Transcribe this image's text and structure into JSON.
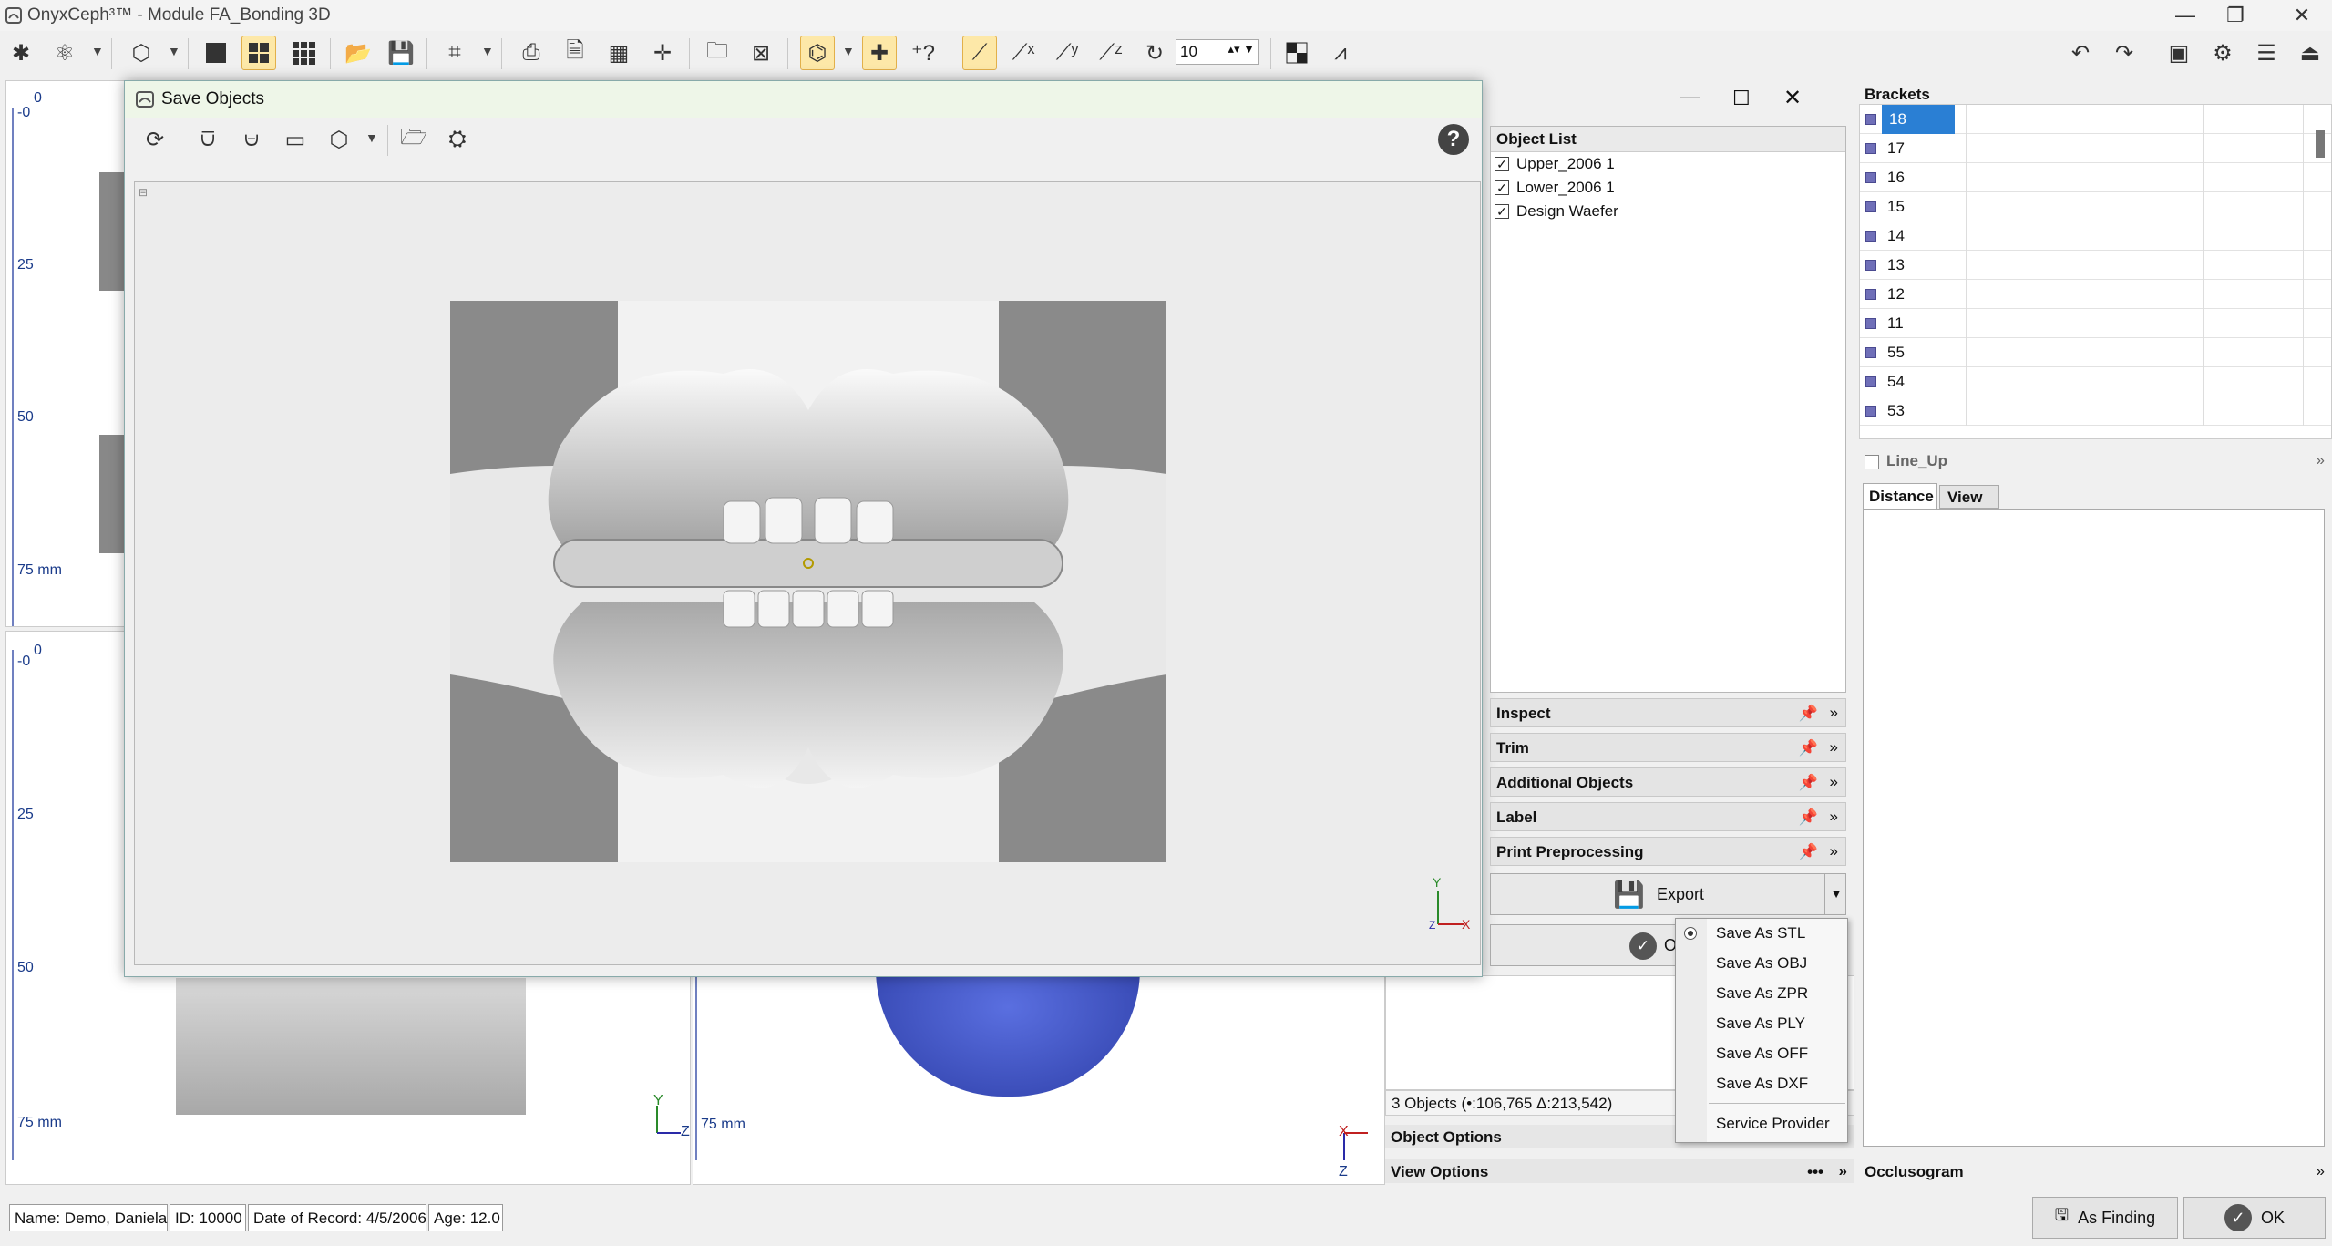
{
  "window": {
    "title": "OnyxCeph³™ - Module FA_Bonding 3D",
    "minimize_glyph": "—",
    "restore_glyph": "❐",
    "close_glyph": "✕"
  },
  "toolbar": {
    "zoom_value": "10"
  },
  "viewports": {
    "top_left": {
      "ticks": [
        "0",
        "-0",
        "25",
        "50",
        "75 mm"
      ]
    },
    "bottom_left": {
      "ticks": [
        "0",
        "-0",
        "25",
        "50",
        "75 mm"
      ]
    },
    "bottom_middle": {
      "tick": "75 mm"
    },
    "axis_y": "Y",
    "axis_z": "Z",
    "axis_x": "X"
  },
  "dialog": {
    "title": "Save Objects",
    "help_glyph": "?",
    "object_list": {
      "header": "Object List",
      "items": [
        {
          "label": "Upper_2006 1",
          "checked": true
        },
        {
          "label": "Lower_2006 1",
          "checked": true
        },
        {
          "label": "Design Waefer",
          "checked": true
        }
      ]
    },
    "sections": {
      "inspect": "Inspect",
      "trim": "Trim",
      "additional_objects": "Additional Objects",
      "label": "Label",
      "print_preprocessing": "Print Preprocessing"
    },
    "export_label": "Export",
    "ok_label_partial": "O",
    "axes": {
      "y": "Y",
      "x": "X",
      "z": "Z"
    }
  },
  "context_menu": {
    "items": [
      {
        "label": "Save As STL",
        "selected": true
      },
      {
        "label": "Save As OBJ",
        "selected": false
      },
      {
        "label": "Save As ZPR",
        "selected": false
      },
      {
        "label": "Save As PLY",
        "selected": false
      },
      {
        "label": "Save As OFF",
        "selected": false
      },
      {
        "label": "Save As DXF",
        "selected": false
      }
    ],
    "service_provider": "Service Provider"
  },
  "lower_panel": {
    "objects_count": "3 Objects (•:106,765 Δ:213,542)",
    "object_options": "Object Options",
    "view_options": "View Options",
    "more_glyph": "•••"
  },
  "brackets": {
    "header": "Brackets",
    "rows": [
      "18",
      "17",
      "16",
      "15",
      "14",
      "13",
      "12",
      "11",
      "55",
      "54",
      "53"
    ],
    "selected_row": "18"
  },
  "line_up": {
    "header": "Line_Up",
    "tabs": [
      "Distance",
      "View"
    ],
    "active_tab": "Distance"
  },
  "occlusogram": {
    "header": "Occlusogram"
  },
  "status": {
    "name": "Name: Demo, Daniela",
    "id": "ID: 10000",
    "date": "Date of Record: 4/5/2006",
    "age": "Age: 12.0"
  },
  "buttons": {
    "as_finding": "As Finding",
    "ok": "OK"
  },
  "colors": {
    "accent_selected": "#2a7fd4",
    "tool_highlight": "#fde8a8",
    "wafer_blue": "#3d55c8"
  }
}
